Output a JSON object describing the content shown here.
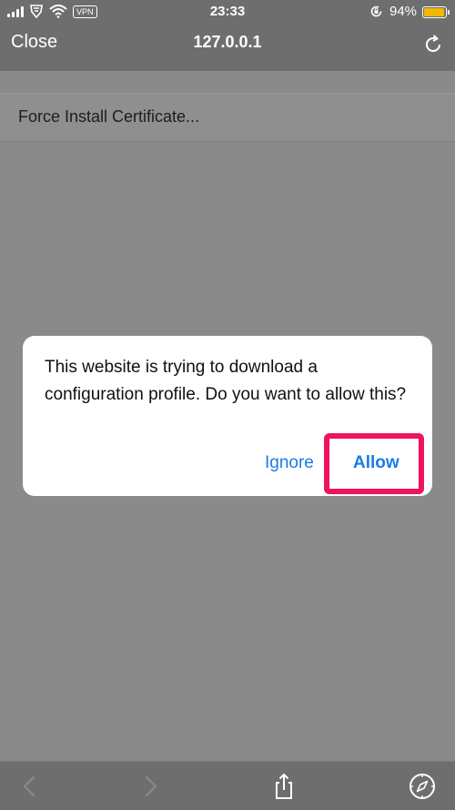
{
  "status_bar": {
    "time": "23:33",
    "vpn_badge": "VPN",
    "battery_percent": "94%",
    "battery_level": 0.94,
    "icons": [
      "signal-icon",
      "carrier-logo-icon",
      "wifi-icon",
      "rotation-lock-icon",
      "battery-icon"
    ]
  },
  "nav": {
    "close_label": "Close",
    "title": "127.0.0.1",
    "reload_icon": "reload-icon"
  },
  "page": {
    "row_label": "Force Install Certificate..."
  },
  "alert": {
    "message": "This website is trying to download a configuration profile. Do you want to allow this?",
    "ignore_label": "Ignore",
    "allow_label": "Allow",
    "highlight_color": "#f0145b",
    "button_color": "#1a7be8"
  },
  "toolbar": {
    "icons": [
      "back-icon",
      "forward-icon",
      "share-icon",
      "compass-icon"
    ]
  }
}
